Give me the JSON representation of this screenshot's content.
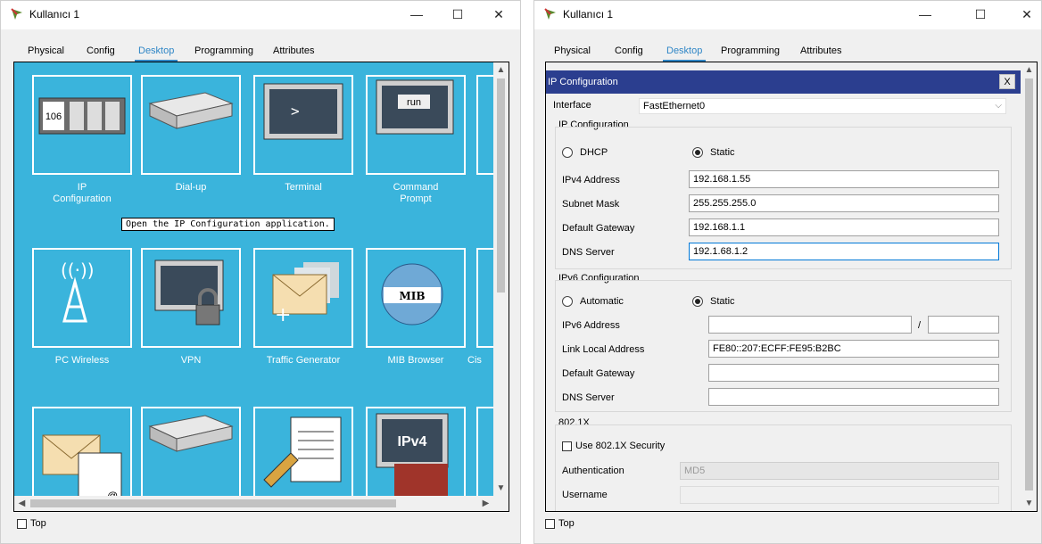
{
  "left_window": {
    "title": "Kullanıcı 1",
    "controls": {
      "minimize": "—",
      "maximize": "☐",
      "close": "✕"
    },
    "tabs": [
      "Physical",
      "Config",
      "Desktop",
      "Programming",
      "Attributes"
    ],
    "active_tab": "Desktop",
    "tooltip": "Open the IP Configuration application.",
    "apps": [
      {
        "label": "IP\nConfiguration",
        "icon": "ip-configuration-icon",
        "icon_text": "106"
      },
      {
        "label": "Dial-up",
        "icon": "dialup-modem-icon"
      },
      {
        "label": "Terminal",
        "icon": "terminal-icon",
        "icon_text": ">"
      },
      {
        "label": "Command\nPrompt",
        "icon": "command-prompt-icon",
        "icon_text": "run"
      },
      {
        "label": "PC Wireless",
        "icon": "wireless-antenna-icon",
        "icon_text": "((·))"
      },
      {
        "label": "VPN",
        "icon": "vpn-lock-icon"
      },
      {
        "label": "Traffic Generator",
        "icon": "traffic-generator-icon"
      },
      {
        "label": "MIB Browser",
        "icon": "mib-browser-icon",
        "icon_text": "MIB"
      },
      {
        "label": "Cis",
        "icon": "partial-app-icon"
      },
      {
        "label": "",
        "icon": "email-icon",
        "icon_text": "@"
      },
      {
        "label": "",
        "icon": "pppoe-dialer-icon"
      },
      {
        "label": "",
        "icon": "text-editor-icon"
      },
      {
        "label": "",
        "icon": "ipv4-firewall-icon",
        "icon_text": "IPv4"
      }
    ],
    "top_checkbox": "Top"
  },
  "right_window": {
    "title": "Kullanıcı 1",
    "controls": {
      "minimize": "—",
      "maximize": "☐",
      "close": "✕"
    },
    "tabs": [
      "Physical",
      "Config",
      "Desktop",
      "Programming",
      "Attributes"
    ],
    "active_tab": "Desktop",
    "panel_title": "IP Configuration",
    "close_label": "X",
    "interface_label": "Interface",
    "interface_value": "FastEthernet0",
    "ipv4": {
      "section_title": "IP Configuration",
      "dhcp_label": "DHCP",
      "static_label": "Static",
      "selected": "Static",
      "fields": [
        {
          "label": "IPv4 Address",
          "value": "192.168.1.55"
        },
        {
          "label": "Subnet Mask",
          "value": "255.255.255.0"
        },
        {
          "label": "Default Gateway",
          "value": "192.168.1.1"
        },
        {
          "label": "DNS Server",
          "value": "192.1.68.1.2"
        }
      ]
    },
    "ipv6": {
      "section_title": "IPv6 Configuration",
      "automatic_label": "Automatic",
      "static_label": "Static",
      "selected": "Static",
      "address_label": "IPv6 Address",
      "address_value": "",
      "prefix_separator": "/",
      "prefix_value": "",
      "link_local_label": "Link Local Address",
      "link_local_value": "FE80::207:ECFF:FE95:B2BC",
      "gateway_label": "Default Gateway",
      "gateway_value": "",
      "dns_label": "DNS Server",
      "dns_value": ""
    },
    "dot1x": {
      "section_title": "802.1X",
      "use_label": "Use 802.1X Security",
      "auth_label": "Authentication",
      "auth_value": "MD5",
      "username_label": "Username",
      "username_value": ""
    },
    "top_checkbox": "Top"
  },
  "colors": {
    "accent": "#2f86c6",
    "desktop_bg": "#3ab4dc",
    "panel_header": "#2b3e8f"
  }
}
